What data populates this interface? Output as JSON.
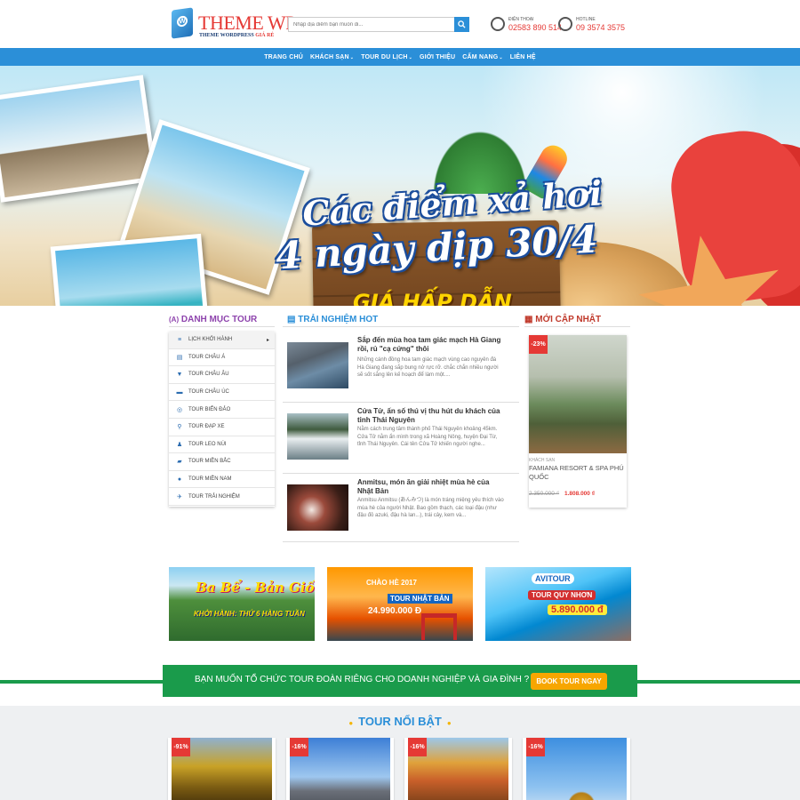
{
  "header": {
    "logo_text": "THEME WP",
    "logo_sub_1": "THEME WORDPRESS",
    "logo_sub_2": "GIÁ RẺ",
    "search_placeholder": "Nhập địa điểm bạn muốn đi...",
    "phone_label": "ĐIỆN THOẠI",
    "phone_number": "02583 890 514",
    "hotline_label": "HOTLINE",
    "hotline_number": "09 3574 3575"
  },
  "nav": {
    "items": [
      {
        "label": "TRANG CHỦ",
        "has_dropdown": false
      },
      {
        "label": "KHÁCH SẠN",
        "has_dropdown": true
      },
      {
        "label": "TOUR DU LỊCH",
        "has_dropdown": true
      },
      {
        "label": "GIỚI THIỆU",
        "has_dropdown": false
      },
      {
        "label": "CẨM NANG",
        "has_dropdown": true
      },
      {
        "label": "LIÊN HỆ",
        "has_dropdown": false
      }
    ]
  },
  "banner": {
    "line1": "Các điểm xả hơi",
    "line2": "4 ngày dịp 30/4",
    "line3": "GIÁ HẤP DẪN",
    "active_slide": 1,
    "slide_count": 2
  },
  "categories": {
    "title": "DANH MỤC TOUR",
    "items": [
      {
        "label": "LỊCH KHỞI HÀNH",
        "icon": "list-icon",
        "has_submenu": true
      },
      {
        "label": "TOUR CHÂU Á",
        "icon": "building-icon",
        "has_submenu": false
      },
      {
        "label": "TOUR CHÂU ÂU",
        "icon": "drink-icon",
        "has_submenu": false
      },
      {
        "label": "TOUR CHÂU ÚC",
        "icon": "bed-icon",
        "has_submenu": false
      },
      {
        "label": "TOUR BIỂN ĐẢO",
        "icon": "lifebuoy-icon",
        "has_submenu": false
      },
      {
        "label": "TOUR ĐẠP XE",
        "icon": "bicycle-icon",
        "has_submenu": false
      },
      {
        "label": "TOUR LEO NÚI",
        "icon": "hiker-icon",
        "has_submenu": false
      },
      {
        "label": "TOUR MIỀN BẮC",
        "icon": "ticket-icon",
        "has_submenu": false
      },
      {
        "label": "TOUR MIỀN NAM",
        "icon": "map-pin-icon",
        "has_submenu": false
      },
      {
        "label": "TOUR TRẢI NGHIỆM",
        "icon": "plane-icon",
        "has_submenu": false
      }
    ]
  },
  "hot": {
    "title": "TRẢI NGHIỆM HOT",
    "posts": [
      {
        "title": "Sắp đến mùa hoa tam giác mạch Hà Giang rồi, rủ \"cạ cứng\" thôi",
        "excerpt": "Những cánh đồng hoa tam giác mạch vùng cao nguyên đá Hà Giang đang sắp bung nở rực rỡ. chắc chắn nhiều người sẽ sốt sắng lên kế hoạch để làm một...."
      },
      {
        "title": "Cửa Tử, ấn số thú vị thu hút du khách của tỉnh Thái Nguyên",
        "excerpt": "Nằm cách trung tâm thành phố Thái Nguyên khoảng 45km. Cửa Tử nằm ẩn mình trong xã Hoàng Nông, huyện Đại Từ, tỉnh Thái Nguyên. Cái tên Cửa Tử khiến người nghe..."
      },
      {
        "title": "Anmitsu, món ăn giải nhiệt mùa hè của Nhật Bản",
        "excerpt": "Anmitsu Anmitsu (あんみつ) là món tráng miệng yêu thích vào mùa hè của người Nhật. Bao gồm thạch, các loại đậu (như đậu đỏ azuki, đậu hà lan...), trái cây, kem và..."
      }
    ]
  },
  "latest": {
    "title": "MỚI CẬP NHẬT",
    "badge": "-23%",
    "category": "KHÁCH SẠN",
    "name": "FAMIANA RESORT & SPA PHÚ QUỐC",
    "old_price": "2.350.000 ₫",
    "new_price": "1.808.000 ₫"
  },
  "promos": [
    {
      "line1": "Ba Bể - Bản Giốc",
      "line2": "KHỞI HÀNH: THỨ 6 HÀNG TUẦN",
      "line3": ""
    },
    {
      "line1": "CHÀO HÈ 2017",
      "line2": "TOUR NHẬT BẢN",
      "line3": "24.990.000 Đ"
    },
    {
      "line1": "AVITOUR",
      "line2": "TOUR QUY NHƠN",
      "line3": "5.890.000 đ"
    }
  ],
  "cta": {
    "text": "BẠN MUỐN TỔ CHỨC TOUR ĐOÀN RIÊNG CHO DOANH NGHIỆP VÀ GIA ĐÌNH ?",
    "button": "BOOK TOUR NGAY"
  },
  "featured": {
    "title": "TOUR NỔI BẬT",
    "cards": [
      {
        "badge": "-91%"
      },
      {
        "badge": "-16%"
      },
      {
        "badge": "-16%"
      },
      {
        "badge": "-16%"
      }
    ]
  },
  "colors": {
    "primary_blue": "#2b8fd8",
    "accent_red": "#e53935",
    "cta_green": "#1a9b4b",
    "cta_button": "#f7a600",
    "category_purple": "#8e44ad"
  }
}
